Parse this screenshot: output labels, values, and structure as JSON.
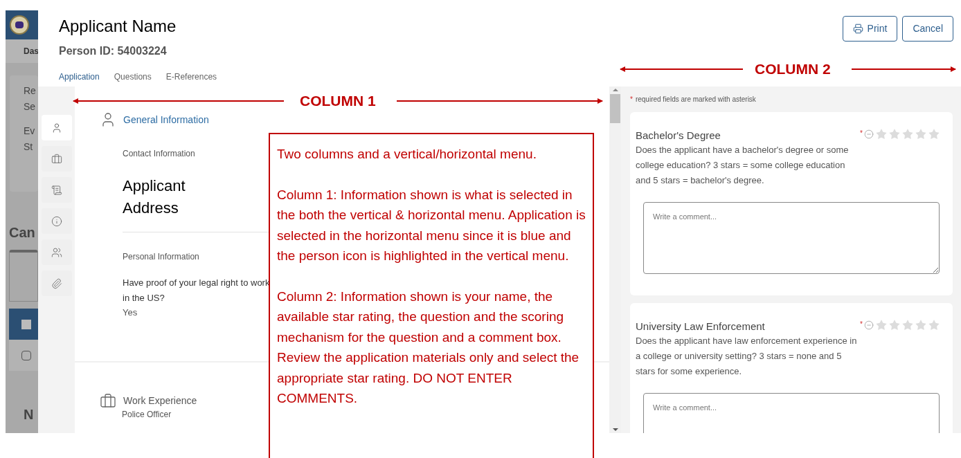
{
  "background": {
    "nav_label": "Das",
    "card_lines": [
      "Re",
      "Se",
      "Ev",
      "St"
    ],
    "heading": "Can",
    "rows": [
      {
        "selected": true,
        "checked": false
      },
      {
        "selected": false,
        "checked": false
      }
    ],
    "footer": "N"
  },
  "header": {
    "title": "Applicant Name",
    "person_id": "Person ID: 54003224",
    "buttons": [
      {
        "label": "Print",
        "kind": "print"
      },
      {
        "label": "Cancel",
        "kind": "plain"
      }
    ]
  },
  "tabs": [
    {
      "label": "Application",
      "selected": true
    },
    {
      "label": "Questions",
      "selected": false
    },
    {
      "label": "E-References",
      "selected": false
    }
  ],
  "side_menu": [
    {
      "kind": "person",
      "selected": true
    },
    {
      "kind": "briefcase",
      "selected": false
    },
    {
      "kind": "diploma",
      "selected": false
    },
    {
      "kind": "info",
      "selected": false
    },
    {
      "kind": "people",
      "selected": false
    },
    {
      "kind": "attachment",
      "selected": false
    }
  ],
  "sections": [
    {
      "kind": "person",
      "title": "General Information",
      "blocks": [
        {
          "heading": "Contact Information",
          "address": "Applicant Address"
        },
        {
          "heading": "Personal Information",
          "question": "Have proof of your legal right to work in the US?",
          "answer": "Yes"
        }
      ]
    },
    {
      "kind": "briefcase",
      "title": "Work Experience",
      "subtitle": "Police Officer"
    }
  ],
  "rating_panel": {
    "required_mark": "*",
    "note": "required fields are marked with asterisk",
    "questions": [
      {
        "title": "Bachelor's Degree",
        "required_mark": "*",
        "text": "Does the applicant have a bachelor's degree or some college education?  3 stars = some college education and 5 stars = bachelor's degree.",
        "stars": 0,
        "placeholder": "Write a comment..."
      },
      {
        "title": "University Law Enforcement",
        "required_mark": "*",
        "text": "Does the applicant have law enforcement experience in a college or university setting?  3 stars = none and 5 stars for some experience.",
        "stars": 0,
        "placeholder": "Write a comment..."
      }
    ]
  },
  "annotations": {
    "column_1": "COLUMN 1",
    "column_2": "COLUMN 2",
    "note": [
      "Two columns and a vertical/horizontal menu.",
      "Column 1: Information shown is what is selected in the both the vertical & horizontal menu.  Application is selected in the horizontal menu since it is blue and the person icon is highlighted in the vertical menu.",
      "Column 2: Information shown is your name, the available star rating, the question and the scoring mechanism for the question and a comment box.  Review the application materials only and select the appropriate star rating.  DO NOT ENTER COMMENTS."
    ]
  }
}
